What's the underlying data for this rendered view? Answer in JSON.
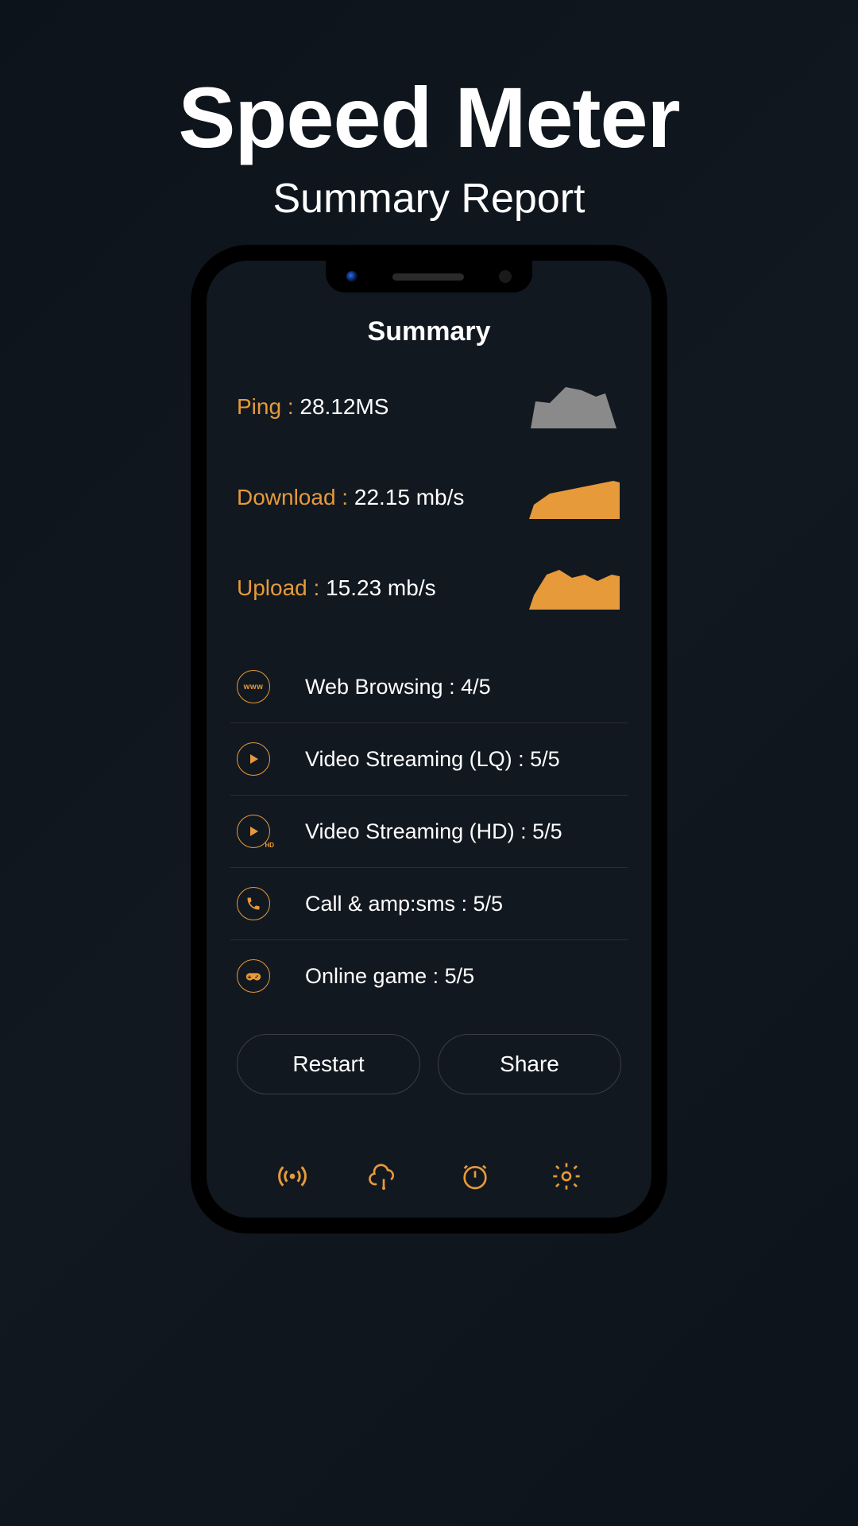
{
  "hero": {
    "title": "Speed Meter",
    "subtitle": "Summary Report"
  },
  "summary": {
    "title": "Summary",
    "metrics": {
      "ping": {
        "label": "Ping : ",
        "value": "28.12MS",
        "color": "#8a8a8a"
      },
      "download": {
        "label": "Download : ",
        "value": "22.15 mb/s",
        "color": "#e69a3a"
      },
      "upload": {
        "label": "Upload : ",
        "value": "15.23 mb/s",
        "color": "#e69a3a"
      }
    },
    "ratings": [
      {
        "icon": "www",
        "label": "Web Browsing : 4/5"
      },
      {
        "icon": "play",
        "label": "Video Streaming (LQ) : 5/5"
      },
      {
        "icon": "play-hd",
        "label": "Video Streaming (HD) : 5/5"
      },
      {
        "icon": "phone",
        "label": "Call & amp:sms : 5/5"
      },
      {
        "icon": "gamepad",
        "label": "Online game : 5/5"
      }
    ],
    "actions": {
      "restart": "Restart",
      "share": "Share"
    }
  },
  "chart_data": [
    {
      "type": "area",
      "series": [
        {
          "name": "Ping",
          "values": [
            30,
            70,
            65,
            100,
            95,
            80,
            90,
            0
          ]
        }
      ],
      "color": "#8a8a8a"
    },
    {
      "type": "area",
      "series": [
        {
          "name": "Download",
          "values": [
            20,
            60,
            70,
            75,
            80,
            85,
            90,
            95
          ]
        }
      ],
      "color": "#e69a3a"
    },
    {
      "type": "area",
      "series": [
        {
          "name": "Upload",
          "values": [
            20,
            70,
            95,
            100,
            85,
            90,
            80,
            90
          ]
        }
      ],
      "color": "#e69a3a"
    }
  ]
}
